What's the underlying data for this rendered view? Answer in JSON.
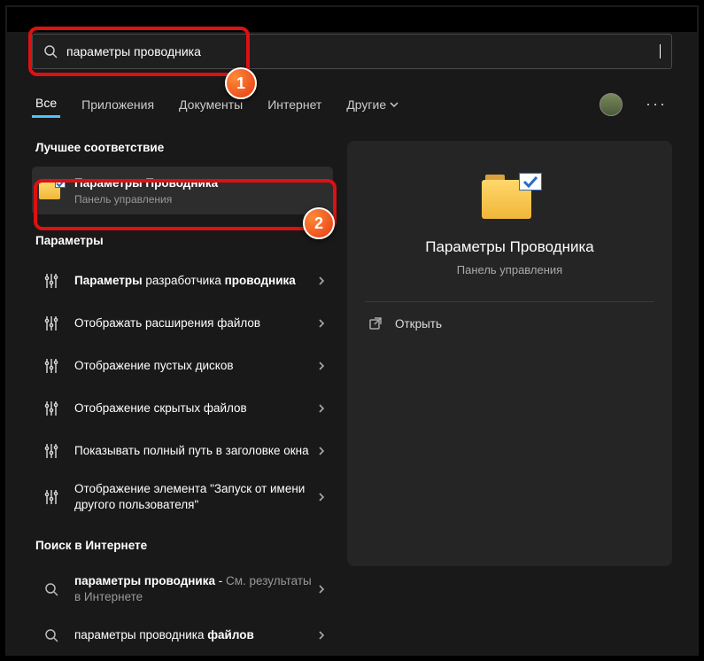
{
  "search": {
    "value": "параметры проводника"
  },
  "tabs": {
    "all": "Все",
    "apps": "Приложения",
    "documents": "Документы",
    "internet": "Интернет",
    "more": "Другие"
  },
  "sections": {
    "best_match": "Лучшее соответствие",
    "parameters": "Параметры",
    "web_search": "Поиск в Интернете"
  },
  "best_match": {
    "title": "Параметры Проводника",
    "sub": "Панель управления"
  },
  "settings_items": [
    {
      "title_html": "<b>Параметры</b> разработчика <b>проводника</b>"
    },
    {
      "title_html": "Отображать расширения файлов"
    },
    {
      "title_html": "Отображение пустых дисков"
    },
    {
      "title_html": "Отображение скрытых файлов"
    },
    {
      "title_html": "Показывать полный путь в заголовке окна"
    },
    {
      "title_html": "Отображение элемента \"Запуск от имени другого пользователя\""
    }
  ],
  "web_items": [
    {
      "title_html": "<b>параметры проводника</b> - <span style='color:#999'>См. результаты в Интернете</span>"
    },
    {
      "title_html": "параметры проводника <b>файлов</b>"
    }
  ],
  "preview": {
    "title": "Параметры Проводника",
    "sub": "Панель управления",
    "open": "Открыть"
  },
  "callouts": {
    "one": "1",
    "two": "2"
  }
}
